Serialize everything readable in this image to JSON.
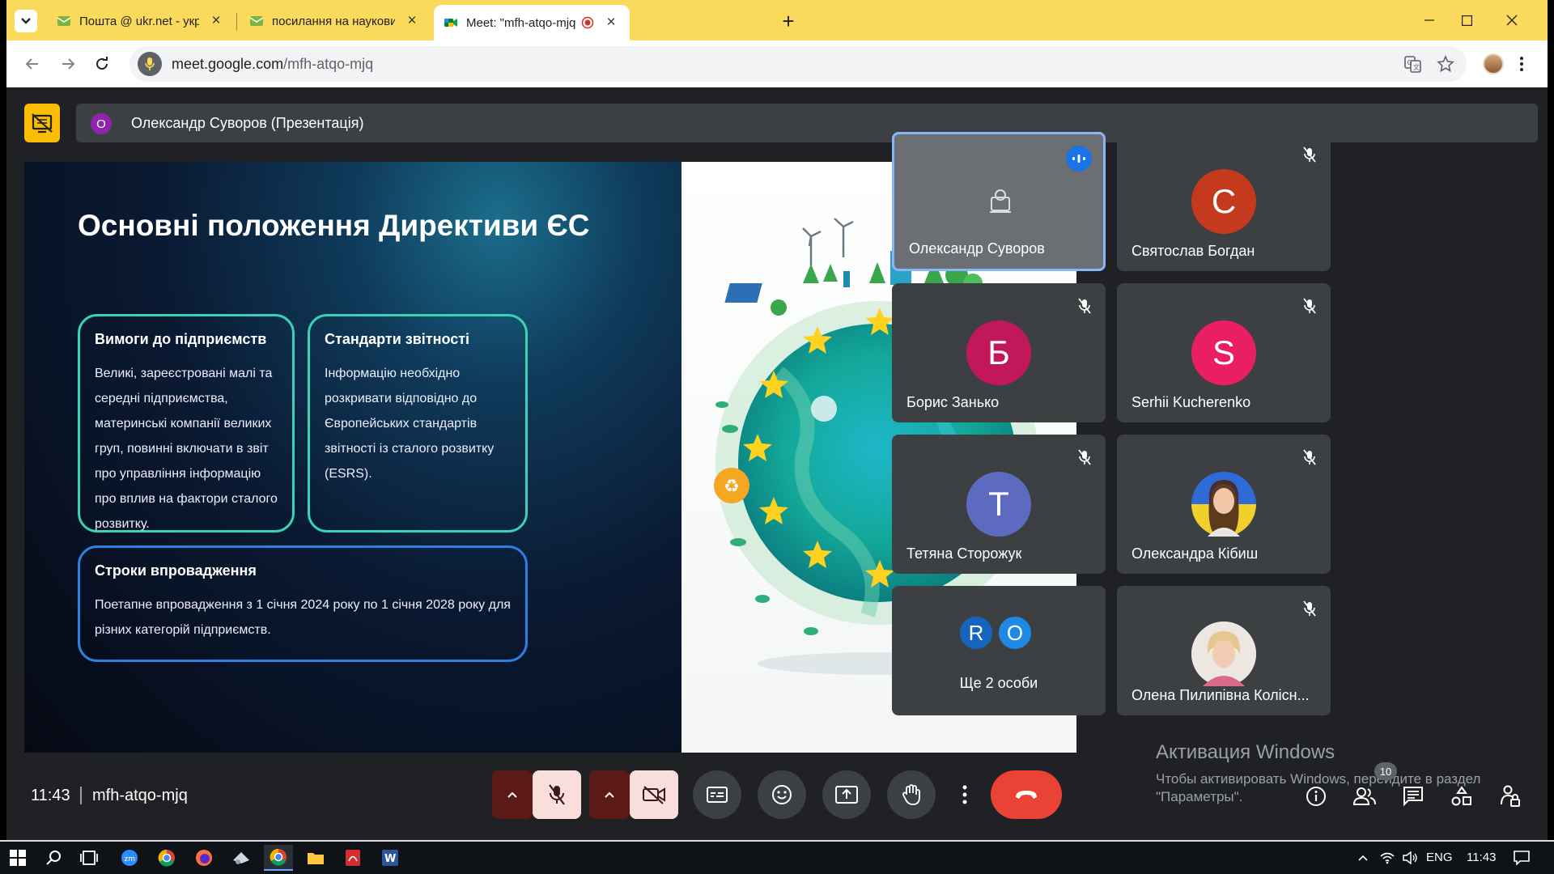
{
  "browser": {
    "tabs": [
      {
        "title": "Пошта @ ukr.net - українська",
        "favicon": "mail-icon"
      },
      {
        "title": "посилання на науковий семін",
        "favicon": "mail-icon"
      },
      {
        "title": "Meet: \"mfh-atqo-mjq\"",
        "favicon": "meet-icon",
        "active": true
      }
    ],
    "new_tab": "+",
    "url_host": "meet.google.com",
    "url_path": "/mfh-atqo-mjq"
  },
  "meet": {
    "presenter_initial": "О",
    "presenter_label": "Олександр Суворов (Презентація)",
    "slide": {
      "title": "Основні положення Директиви ЄС",
      "cards": [
        {
          "title": "Вимоги до підприємств",
          "body": "Великі, зареєстровані малі та середні підприємства, материнські компанії великих груп, повинні включати в звіт про управління інформацію про вплив на фактори сталого розвитку."
        },
        {
          "title": "Стандарти звітності",
          "body": "Інформацію необхідно розкривати відповідно до Європейських стандартів звітності із сталого розвитку (ESRS)."
        },
        {
          "title": "Строки впровадження",
          "body": "Поетапне впровадження з 1 січня 2024 року по 1 січня 2028 року для різних категорій підприємств."
        }
      ]
    },
    "participants": [
      {
        "name": "Олександр Суворов",
        "initial": "",
        "color": "",
        "state": "speaking"
      },
      {
        "name": "Святослав Богдан",
        "initial": "С",
        "color": "#c5391d",
        "state": "muted"
      },
      {
        "name": "Борис Занько",
        "initial": "Б",
        "color": "#c2185b",
        "state": "muted"
      },
      {
        "name": "Serhii Kucherenko",
        "initial": "S",
        "color": "#e91e63",
        "state": "muted"
      },
      {
        "name": "Тетяна Сторожук",
        "initial": "Т",
        "color": "#5c6bc0",
        "state": "muted"
      },
      {
        "name": "Олександра Кібиш",
        "initial": "",
        "color": "",
        "state": "muted"
      },
      {
        "name": "Ще 2 особи",
        "initials": [
          "R",
          "O"
        ],
        "colors": [
          "#1565c0",
          "#1e88e5"
        ],
        "state": "group"
      },
      {
        "name": "Олена Пилипівна Колісн...",
        "initial": "",
        "color": "",
        "state": "muted"
      }
    ],
    "time": "11:43",
    "meeting_code": "mfh-atqo-mjq",
    "people_count": "10",
    "activation": {
      "title": "Активация Windows",
      "line1": "Чтобы активировать Windows, перейдите в раздел",
      "line2": "\"Параметры\"."
    }
  },
  "taskbar": {
    "language": "ENG",
    "time": "11:43"
  },
  "colors": {
    "chrome_frame": "#fbd95a",
    "meet_bg": "#202124",
    "tile_bg": "#3c4043",
    "hangup": "#ea4335",
    "card_border_teal": "#37d3b4",
    "card_border_blue": "#2f7fe0"
  }
}
